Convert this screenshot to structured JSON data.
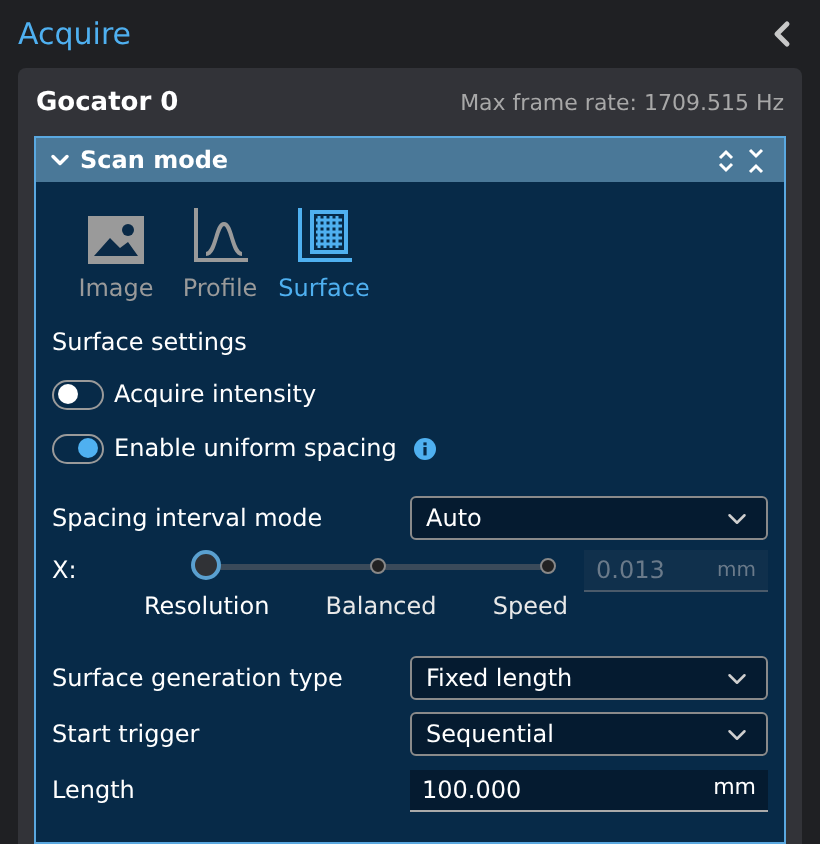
{
  "header": {
    "title": "Acquire"
  },
  "sensor": {
    "name": "Gocator 0",
    "max_frame_rate": "Max frame rate: 1709.515 Hz"
  },
  "panel": {
    "title": "Scan mode",
    "expanded": true
  },
  "modes": [
    {
      "kind": "image",
      "label": "Image",
      "selected": false
    },
    {
      "kind": "profile",
      "label": "Profile",
      "selected": false
    },
    {
      "kind": "surface",
      "label": "Surface",
      "selected": true
    }
  ],
  "section_title": "Surface settings",
  "toggles": [
    {
      "label": "Acquire intensity",
      "on": false,
      "info": false
    },
    {
      "label": "Enable uniform spacing",
      "on": true,
      "info": true
    }
  ],
  "spacing_mode": {
    "label": "Spacing interval mode",
    "value": "Auto"
  },
  "spacing_slider": {
    "axis": "X:",
    "stops": [
      {
        "label": "Resolution",
        "selected": true
      },
      {
        "label": "Balanced",
        "selected": false
      },
      {
        "label": "Speed",
        "selected": false
      }
    ],
    "value": "0.013",
    "unit": "mm",
    "disabled": true
  },
  "fields": [
    {
      "kind": "select",
      "label": "Surface generation type",
      "value": "Fixed length"
    },
    {
      "kind": "select",
      "label": "Start trigger",
      "value": "Sequential"
    },
    {
      "kind": "number",
      "label": "Length",
      "value": "100.000",
      "unit": "mm"
    }
  ]
}
